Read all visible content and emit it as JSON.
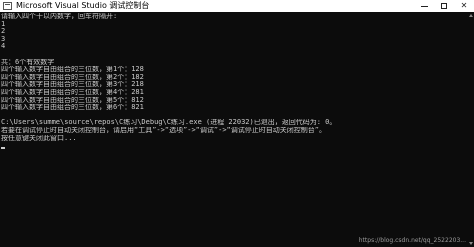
{
  "window": {
    "title": "Microsoft Visual Studio 调试控制台",
    "minimize_label": "—",
    "maximize_label": "",
    "close_label": "✕"
  },
  "console": {
    "lines": [
      "请输入四个十以内数字，回车符隔开:",
      "1",
      "2",
      "3",
      "4",
      "",
      "共：6个有效数字",
      "四个输入数字自由组合的三位数，第1个：128",
      "四个输入数字自由组合的三位数，第2个：182",
      "四个输入数字自由组合的三位数，第3个：218",
      "四个输入数字自由组合的三位数，第4个：281",
      "四个输入数字自由组合的三位数，第5个：812",
      "四个输入数字自由组合的三位数，第6个：821",
      "",
      "C:\\Users\\summe\\source\\repos\\C练习\\Debug\\C练习.exe (进程 22032)已退出，返回代码为: 0。",
      "若要在调试停止时自动关闭控制台，请启用“工具”->“选项”->“调试”->“调试停止时自动关闭控制台”。",
      "按任意键关闭此窗口..."
    ]
  },
  "watermark": "https://blog.csdn.net/qq_2522203..."
}
